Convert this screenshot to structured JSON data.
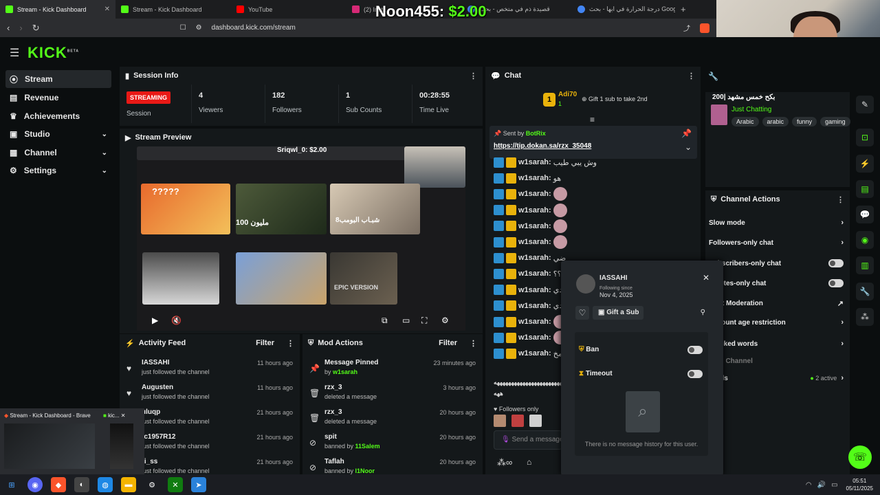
{
  "tabs": [
    {
      "title": "Stream - Kick Dashboard",
      "color": "#53fc18",
      "active": true
    },
    {
      "title": "Stream - Kick Dashboard",
      "color": "#53fc18"
    },
    {
      "title": "YouTube",
      "color": "#ff0000"
    },
    {
      "title": "(2) Insta",
      "color": "#d62976"
    },
    {
      "title": "قصيدة ذم في متخص - بحث",
      "color": "#4285f4"
    },
    {
      "title": "درجة الحرارة في ابها - بحث Google",
      "color": "#4285f4"
    }
  ],
  "url": "dashboard.kick.com/stream",
  "donation": {
    "name": "Noon455:",
    "amount": "$2.00"
  },
  "nav": {
    "logo": "KICK",
    "logo_sup": "BETA",
    "items": [
      "Stream",
      "Revenue",
      "Achievements",
      "Studio",
      "Channel",
      "Settings"
    ]
  },
  "session": {
    "title": "Session Info",
    "live": "STREAMING",
    "live_label": "Session",
    "stats": [
      {
        "v": "4",
        "l": "Viewers"
      },
      {
        "v": "182",
        "l": "Followers"
      },
      {
        "v": "1",
        "l": "Sub Counts"
      },
      {
        "v": "00:28:55",
        "l": "Time Live"
      }
    ]
  },
  "preview": {
    "title": "Stream Preview",
    "overlay_text": "Sriqwl_0: $2.00",
    "thumb_label": "100 مليون",
    "thumb_label2": "شبـاب البومب8",
    "thumb_label3": "EPIC VERSION",
    "thumb_q": "?????"
  },
  "activity": {
    "title": "Activity Feed",
    "filter": "Filter",
    "rows": [
      {
        "name": "IASSAHI",
        "sub": "just followed the channel",
        "time": "11 hours ago"
      },
      {
        "name": "Augusten",
        "sub": "just followed the channel",
        "time": "11 hours ago"
      },
      {
        "name": "uluqp",
        "sub": "just followed the channel",
        "time": "21 hours ago"
      },
      {
        "name": "fc1957R12",
        "sub": "just followed the channel",
        "time": "21 hours ago"
      },
      {
        "name": "ri_ss",
        "sub": "just followed the channel",
        "time": "21 hours ago"
      }
    ]
  },
  "mod": {
    "title": "Mod Actions",
    "filter": "Filter",
    "rows": [
      {
        "name": "Message Pinned",
        "sub": "by ",
        "who": "w1sarah",
        "time": "23 minutes ago",
        "icon": "pin"
      },
      {
        "name": "rzx_3",
        "sub": "deleted a message",
        "who": "",
        "time": "3 hours ago",
        "icon": "trash"
      },
      {
        "name": "rzx_3",
        "sub": "deleted a message",
        "who": "",
        "time": "20 hours ago",
        "icon": "trash"
      },
      {
        "name": "spit",
        "sub": "banned by ",
        "who": "11Salem",
        "time": "20 hours ago",
        "icon": "ban"
      },
      {
        "name": "Taflah",
        "sub": "banned by ",
        "who": "l1Noor",
        "time": "20 hours ago",
        "icon": "ban"
      }
    ]
  },
  "chat": {
    "title": "Chat",
    "gifter": "Adi70",
    "gifter_count": "1",
    "gift_text": "Gift 1 sub to take 2nd",
    "pinned_by": "Sent by",
    "pinned_user": "BotRix",
    "pinned_link": "https://tip.dokan.sa/rzx_35048",
    "lines": [
      {
        "u": "w1sarah:",
        "m": "وش يبي طيب"
      },
      {
        "u": "w1sarah:",
        "m": "هو"
      },
      {
        "u": "w1sarah:",
        "m": ""
      },
      {
        "u": "w1sarah:",
        "m": ""
      },
      {
        "u": "w1sarah:",
        "m": ""
      },
      {
        "u": "w1sarah:",
        "m": ""
      },
      {
        "u": "w1sarah:",
        "m": "ضي"
      },
      {
        "u": "w1sarah:",
        "m": "؟؟؟"
      },
      {
        "u": "w1sarah:",
        "m": "ندي"
      },
      {
        "u": "w1sarah:",
        "m": "ندي"
      },
      {
        "u": "w1sarah:",
        "m": ""
      },
      {
        "u": "w1sarah:",
        "m": ""
      },
      {
        "u": "w1sarah:",
        "m": "مخ"
      }
    ],
    "tail1": "ههههههههههههههههههههههههه",
    "tail2": "ههه",
    "followers_only": "Followers only",
    "input_placeholder": "Send a message"
  },
  "info": {
    "title": "بكح خمس مشهد |200",
    "category": "Just Chatting",
    "tags": [
      "Arabic",
      "arabic",
      "funny",
      "gaming"
    ]
  },
  "actions": {
    "title": "Channel Actions",
    "rows": [
      {
        "label": "Slow mode",
        "type": "arrow"
      },
      {
        "label": "Followers-only chat",
        "type": "arrow"
      },
      {
        "label": "Subscribers-only chat",
        "type": "toggle"
      },
      {
        "label": "Emotes-only chat",
        "type": "toggle"
      },
      {
        "label": "Chat Moderation",
        "type": "ext"
      },
      {
        "label": "Account age restriction",
        "type": "arrow"
      },
      {
        "label": "Blocked words",
        "type": "arrow"
      },
      {
        "label": "Raid Channel",
        "type": "none"
      },
      {
        "label": "Goals",
        "type": "goals",
        "extra": "2 active"
      }
    ]
  },
  "popup": {
    "user": "IASSAHI",
    "following_since": "Following since",
    "date": "Nov 4, 2025",
    "gift": "Gift a Sub",
    "ban": "Ban",
    "timeout": "Timeout",
    "empty": "There is no message history for this user."
  },
  "taskbar": {
    "preview_title": "Stream - Kick Dashboard - Brave",
    "preview_title2": "kic...",
    "time": "05:51",
    "date": "05/11/2025"
  },
  "colors": {
    "accent": "#53fc18",
    "live": "#e91916"
  }
}
